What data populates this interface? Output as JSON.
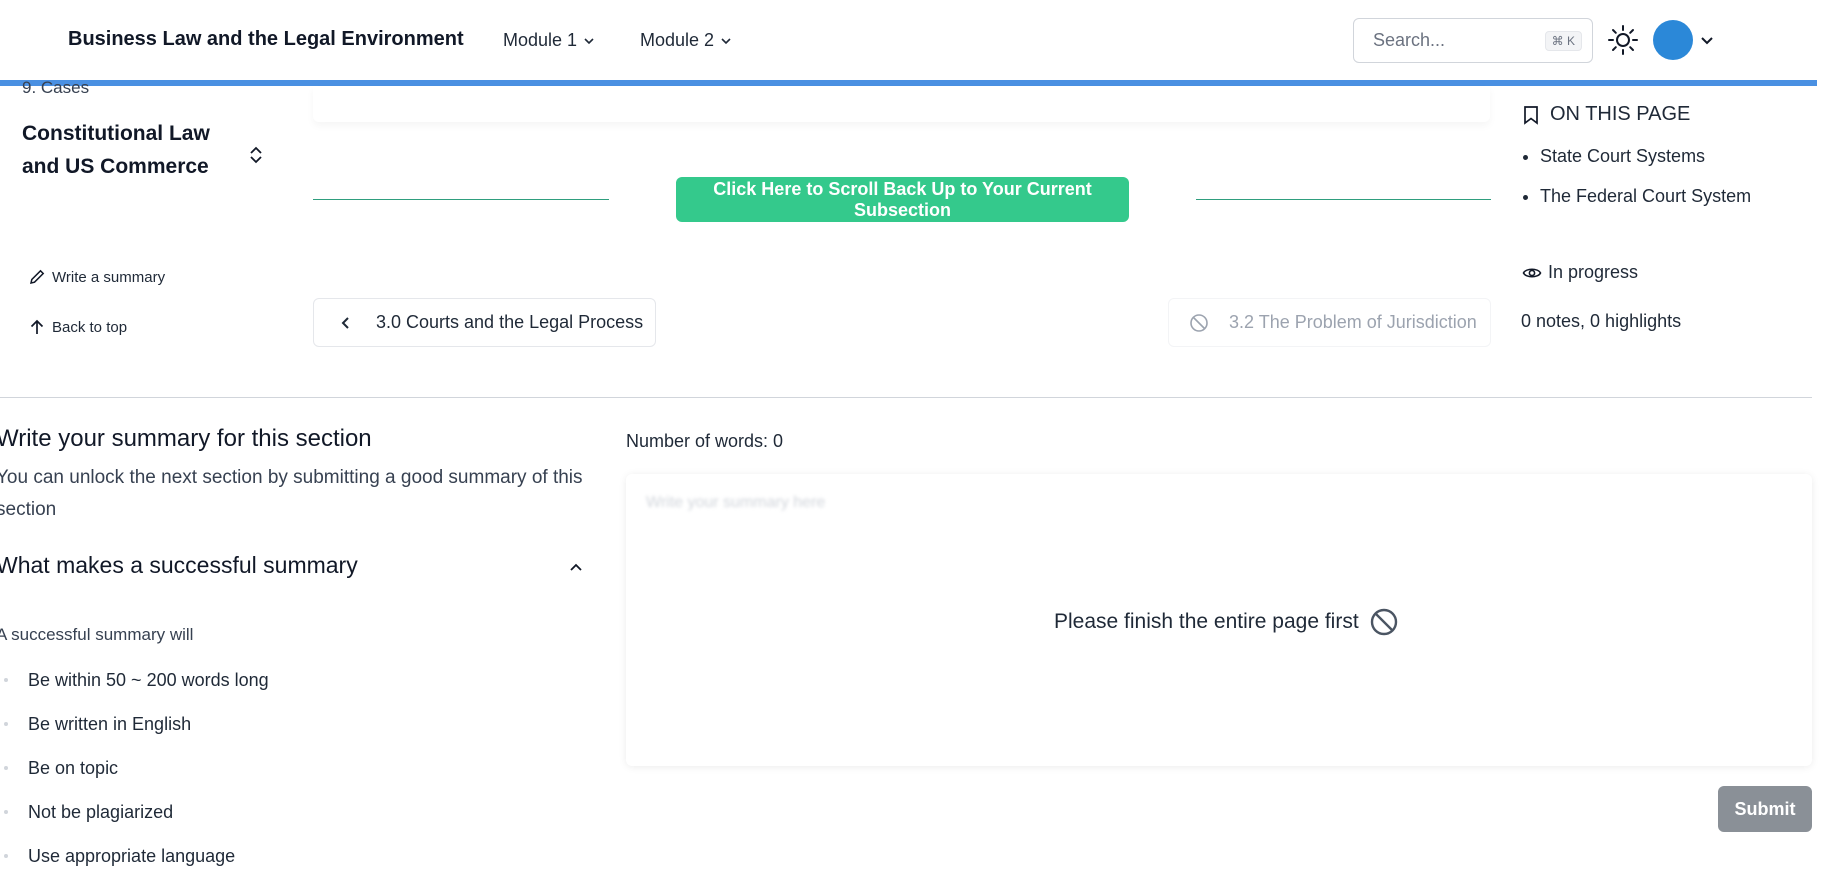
{
  "header": {
    "brand": "Business Law and the Legal Environment",
    "nav": [
      {
        "label": "Module 1"
      },
      {
        "label": "Module 2"
      }
    ],
    "search": {
      "placeholder": "Search...",
      "shortcut": "⌘ K"
    }
  },
  "colors": {
    "accent_blue": "#4a90e2",
    "scroll_button": "#34c98c",
    "avatar": "#2b88d8",
    "submit_disabled": "#8a9097"
  },
  "sidebar": {
    "chapter_label": "9. Cases",
    "chapter_title": "Constitutional Law and US Commerce",
    "write_summary": "Write a summary",
    "back_to_top": "Back to top"
  },
  "content": {
    "scroll_back_label": "Click Here to Scroll Back Up to Your Current Subsection",
    "prev_section": "3.0 Courts and the Legal Process",
    "next_section": "3.2 The Problem of Jurisdiction"
  },
  "on_this_page": {
    "title": "ON THIS PAGE",
    "items": [
      "State Court Systems",
      "The Federal Court System"
    ],
    "status": "In progress",
    "notes": "0 notes, 0 highlights"
  },
  "summary": {
    "title": "Write your summary for this section",
    "description": "You can unlock the next section by submitting a good summary of this section",
    "criteria_heading": "What makes a successful summary",
    "criteria_intro": "A successful summary will",
    "criteria": [
      "Be within 50 ~ 200 words long",
      "Be written in English",
      "Be on topic",
      "Not be plagiarized",
      "Use appropriate language"
    ],
    "word_count": "Number of words: 0",
    "textarea_placeholder": "Write your summary here",
    "locked_message": "Please finish the entire page first",
    "submit_label": "Submit"
  }
}
